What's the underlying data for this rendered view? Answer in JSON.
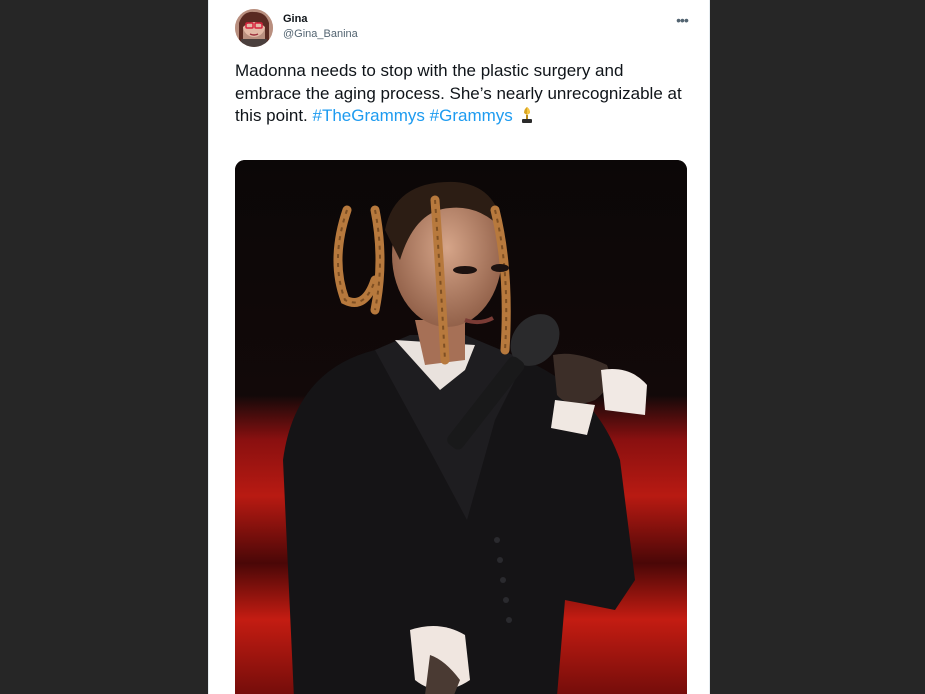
{
  "tweet": {
    "author": {
      "display_name": "Gina",
      "handle": "@Gina_Banina"
    },
    "more_icon": "ellipsis-icon",
    "text_parts": {
      "p1": "Madonna needs to stop with the plastic surgery and embrace the aging process. She’s nearly unrecognizable at this point. ",
      "hashtag1": "#TheGrammys",
      "hashtag2": "#Grammys"
    },
    "emoji": "trophy-emoji",
    "media": {
      "icon": "photo",
      "alt": ""
    },
    "colors": {
      "accent": "#1d9bf0",
      "text": "#0f1419",
      "secondary": "#536471"
    }
  }
}
